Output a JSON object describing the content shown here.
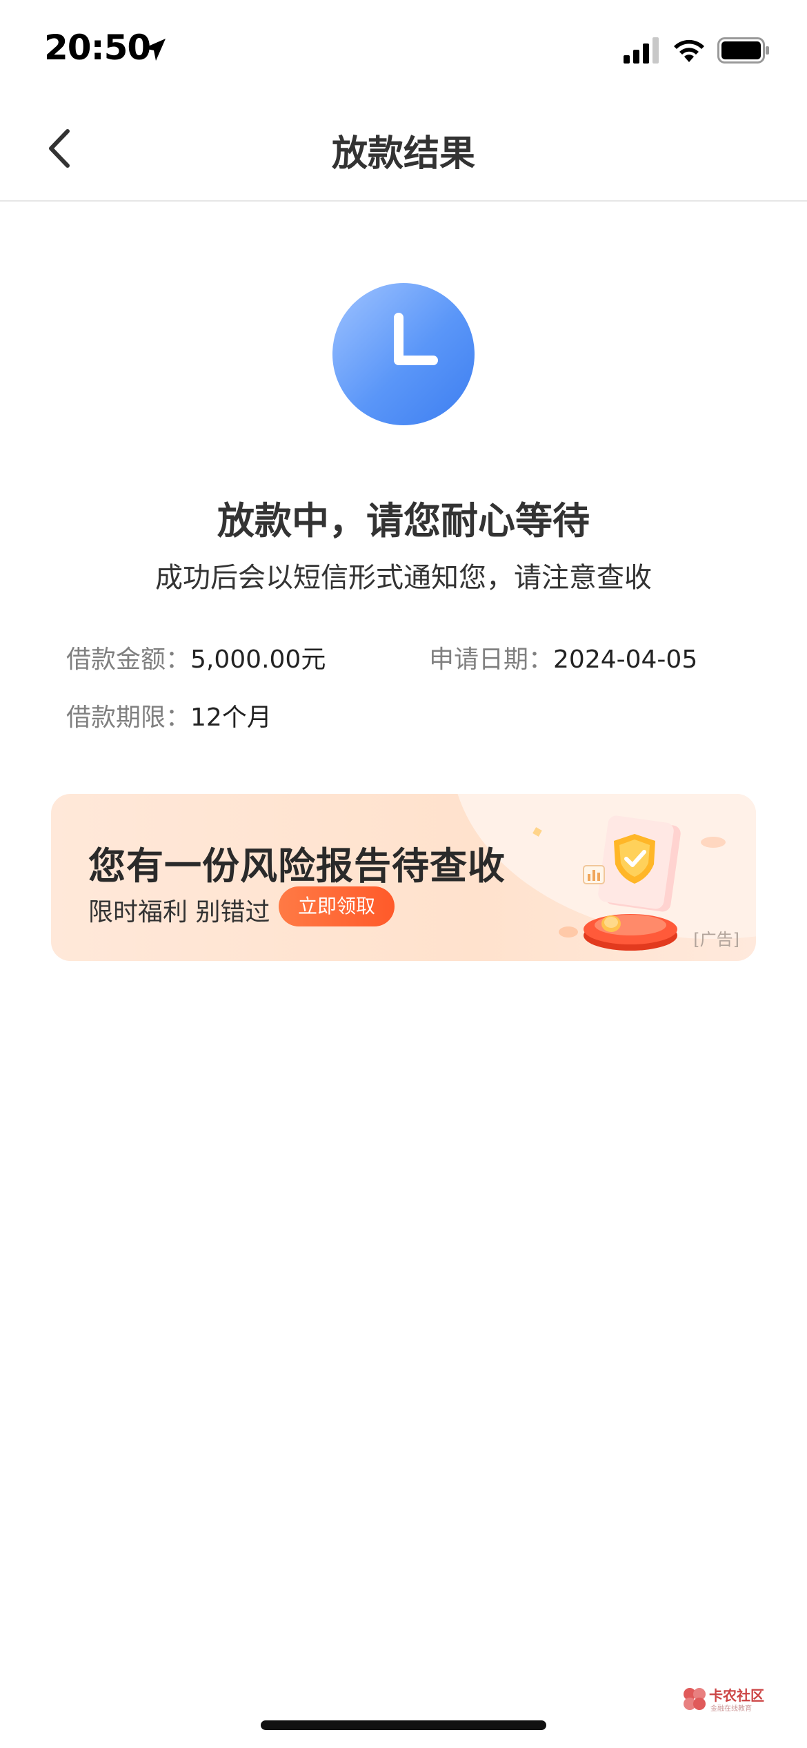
{
  "status_bar": {
    "time": "20:50",
    "icons": [
      "location-arrow-icon",
      "cellular-signal-icon",
      "wifi-icon",
      "battery-icon"
    ]
  },
  "nav": {
    "back_icon": "chevron-left-icon",
    "title": "放款结果"
  },
  "result": {
    "icon": "clock-icon",
    "icon_color": "#5a96f8",
    "title": "放款中，请您耐心等待",
    "subtitle": "成功后会以短信形式通知您，请注意查收"
  },
  "loan_info": {
    "amount_label": "借款金额：",
    "amount_value": "5,000.00元",
    "date_label": "申请日期：",
    "date_value": "2024-04-05",
    "term_label": "借款期限：",
    "term_value": "12个月"
  },
  "ad": {
    "title": "您有一份风险报告待查收",
    "subtitle": "限时福利 别错过",
    "cta_label": "立即领取",
    "tag": "[广告]",
    "accent_color": "#ff5a2a"
  },
  "watermark": {
    "text": "卡农社区",
    "sub": "金融在线教育"
  }
}
